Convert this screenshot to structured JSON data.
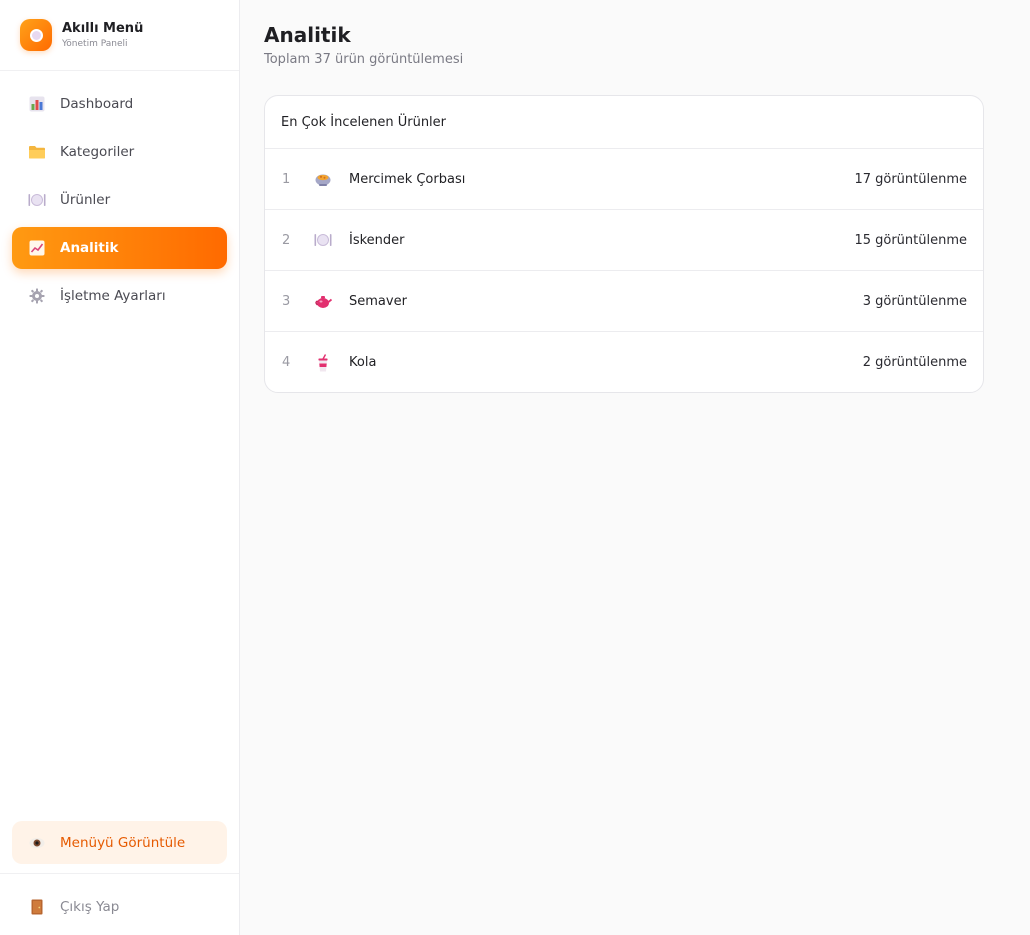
{
  "brand": {
    "title": "Akıllı Menü",
    "subtitle": "Yönetim Paneli",
    "logo_icon": "menu-plate-logo"
  },
  "nav": [
    {
      "label": "Dashboard",
      "icon": "bar-chart-icon",
      "active": false
    },
    {
      "label": "Kategoriler",
      "icon": "folder-icon",
      "active": false
    },
    {
      "label": "Ürünler",
      "icon": "plate-icon",
      "active": false
    },
    {
      "label": "Analitik",
      "icon": "trend-chart-icon",
      "active": true
    },
    {
      "label": "İşletme Ayarları",
      "icon": "gear-icon",
      "active": false
    }
  ],
  "footer": {
    "view_menu_label": "Menüyü Görüntüle",
    "view_menu_icon": "eye-icon",
    "logout_label": "Çıkış Yap",
    "logout_icon": "door-icon"
  },
  "page": {
    "title": "Analitik",
    "subtitle": "Toplam 37 ürün görüntülemesi"
  },
  "top_products": {
    "header": "En Çok İncelenen Ürünler",
    "rows": [
      {
        "rank": "1",
        "icon": "soup-bowl-icon",
        "name": "Mercimek Çorbası",
        "views": "17 görüntülenme"
      },
      {
        "rank": "2",
        "icon": "plate-icon",
        "name": "İskender",
        "views": "15 görüntülenme"
      },
      {
        "rank": "3",
        "icon": "teapot-icon",
        "name": "Semaver",
        "views": "3 görüntülenme"
      },
      {
        "rank": "4",
        "icon": "cup-straw-icon",
        "name": "Kola",
        "views": "2 görüntülenme"
      }
    ]
  },
  "colors": {
    "accent": "#ff7a00",
    "accent_light": "#ffa21a",
    "view_menu_bg": "#fff3e8",
    "view_menu_text": "#e65a00"
  }
}
